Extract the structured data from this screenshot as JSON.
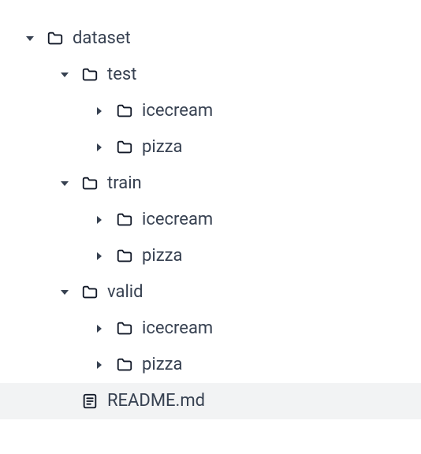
{
  "tree": {
    "root": {
      "label": "dataset",
      "children": [
        {
          "label": "test",
          "children": [
            {
              "label": "icecream"
            },
            {
              "label": "pizza"
            }
          ]
        },
        {
          "label": "train",
          "children": [
            {
              "label": "icecream"
            },
            {
              "label": "pizza"
            }
          ]
        },
        {
          "label": "valid",
          "children": [
            {
              "label": "icecream"
            },
            {
              "label": "pizza"
            }
          ]
        },
        {
          "label": "README.md",
          "type": "file",
          "selected": true
        }
      ]
    }
  }
}
